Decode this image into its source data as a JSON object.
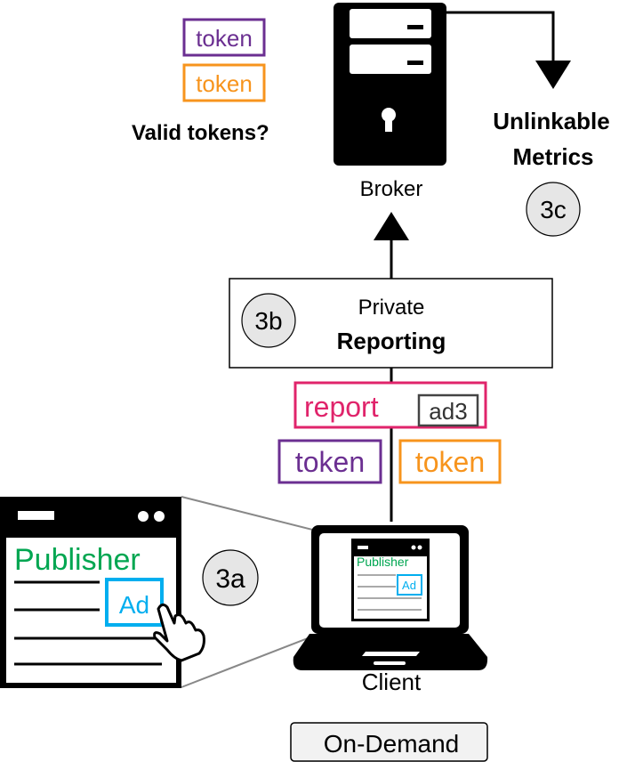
{
  "colors": {
    "purple": "#6b2f91",
    "orange": "#f7941d",
    "pink": "#e0246b",
    "green": "#00a651",
    "blue": "#00aeef",
    "circle_fill": "#e6e6e6"
  },
  "broker": {
    "label": "Broker",
    "token_a": "token",
    "token_b": "token",
    "question": "Valid tokens?",
    "icon": "server-icon"
  },
  "metrics": {
    "line1": "Unlinkable",
    "line2": "Metrics",
    "step": "3c"
  },
  "reporting": {
    "line1": "Private",
    "line2": "Reporting",
    "step": "3b"
  },
  "report_msg": {
    "label": "report",
    "ad": "ad3",
    "token_a": "token",
    "token_b": "token"
  },
  "client": {
    "label": "Client",
    "mode": "On-Demand",
    "icon": "laptop-icon",
    "step": "3a",
    "browser": {
      "publisher": "Publisher",
      "ad": "Ad"
    }
  }
}
